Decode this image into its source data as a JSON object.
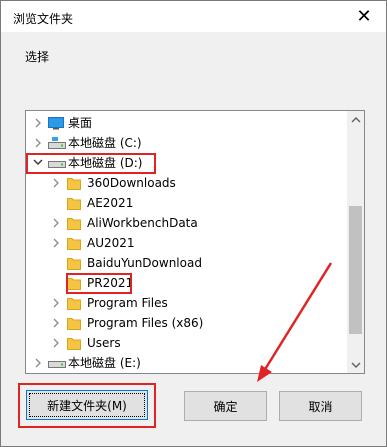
{
  "window": {
    "title": "浏览文件夹",
    "close_glyph": "✕"
  },
  "prompt": "选择",
  "tree": {
    "items": [
      {
        "label": "桌面",
        "icon": "desktop-icon",
        "level": 0,
        "expanded": false
      },
      {
        "label": "本地磁盘 (C:)",
        "icon": "drive-icon",
        "level": 0,
        "expanded": false
      },
      {
        "label": "本地磁盘 (D:)",
        "icon": "drive-icon",
        "level": 0,
        "expanded": true
      },
      {
        "label": "360Downloads",
        "icon": "folder-icon",
        "level": 1
      },
      {
        "label": "AE2021",
        "icon": "folder-icon",
        "level": 1
      },
      {
        "label": "AliWorkbenchData",
        "icon": "folder-icon",
        "level": 1
      },
      {
        "label": "AU2021",
        "icon": "folder-icon",
        "level": 1
      },
      {
        "label": "BaiduYunDownload",
        "icon": "folder-icon",
        "level": 1
      },
      {
        "label": "PR2021",
        "icon": "folder-icon",
        "level": 1
      },
      {
        "label": "Program Files",
        "icon": "folder-icon",
        "level": 1
      },
      {
        "label": "Program Files (x86)",
        "icon": "folder-icon",
        "level": 1
      },
      {
        "label": "Users",
        "icon": "folder-icon",
        "level": 1
      },
      {
        "label": "本地磁盘 (E:)",
        "icon": "drive-icon",
        "level": 0,
        "expanded": false
      }
    ]
  },
  "buttons": {
    "new_folder": "新建文件夹(M)",
    "ok": "确定",
    "cancel": "取消"
  },
  "colors": {
    "annotation_red": "#e02424",
    "folder_yellow": "#f4c542",
    "accent_blue": "#0078d7"
  }
}
